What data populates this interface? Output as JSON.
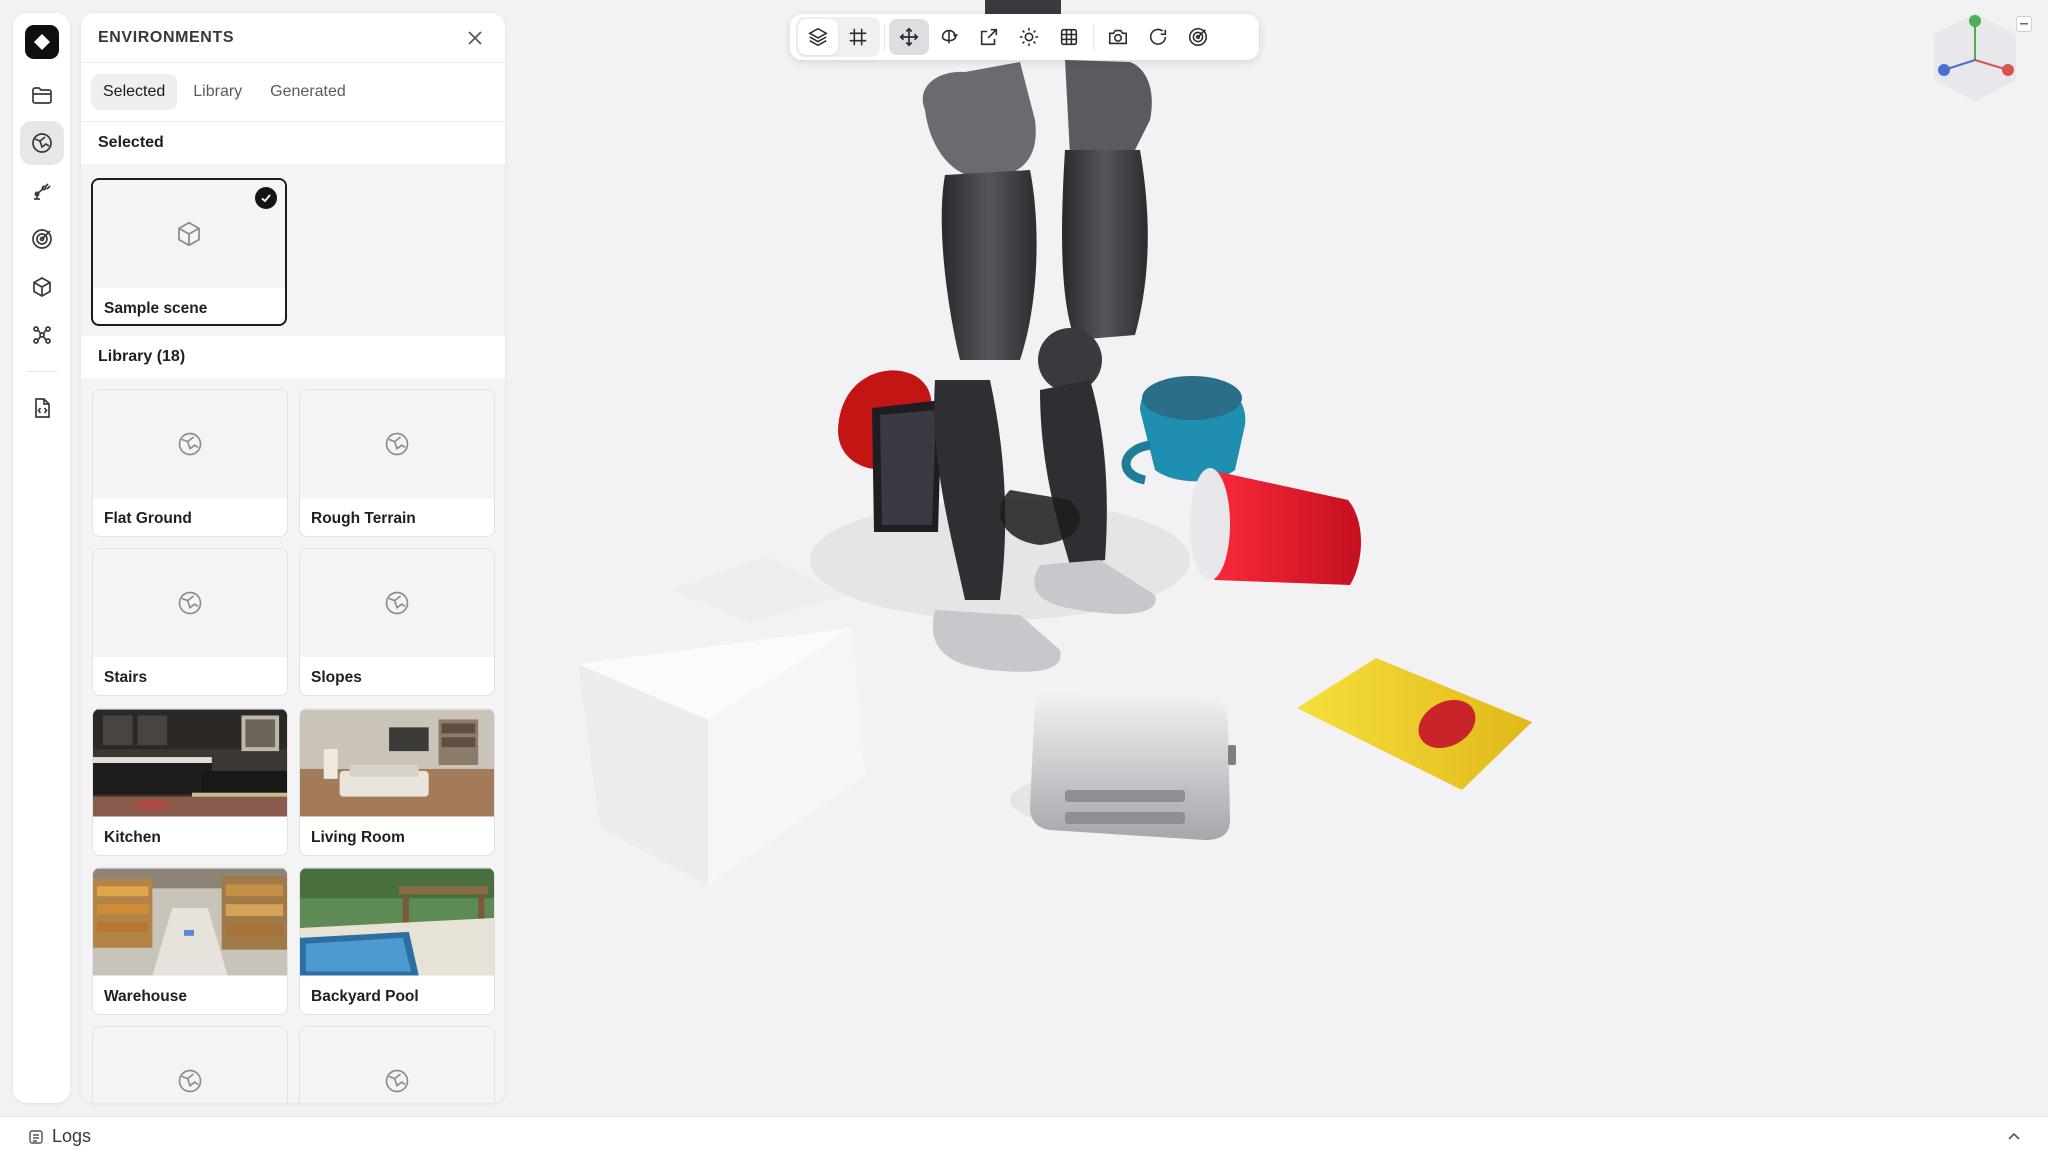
{
  "panel": {
    "title": "ENVIRONMENTS",
    "tabs": [
      "Selected",
      "Library",
      "Generated"
    ],
    "active_tab": "Selected",
    "selected_section": {
      "label": "Selected",
      "items": [
        {
          "name": "Sample scene",
          "icon": "cube-icon",
          "selected": true
        }
      ]
    },
    "library_section": {
      "label": "Library (18)",
      "items": [
        {
          "name": "Flat Ground",
          "icon": "globe-icon"
        },
        {
          "name": "Rough Terrain",
          "icon": "globe-icon"
        },
        {
          "name": "Stairs",
          "icon": "globe-icon"
        },
        {
          "name": "Slopes",
          "icon": "globe-icon"
        },
        {
          "name": "Kitchen",
          "icon": "kitchen-thumbnail"
        },
        {
          "name": "Living Room",
          "icon": "living-room-thumbnail"
        },
        {
          "name": "Warehouse",
          "icon": "warehouse-thumbnail"
        },
        {
          "name": "Backyard Pool",
          "icon": "pool-thumbnail"
        },
        {
          "name": "",
          "icon": "globe-icon"
        },
        {
          "name": "",
          "icon": "globe-icon"
        }
      ]
    }
  },
  "rail": {
    "items": [
      "files-icon",
      "environment-icon",
      "robot-arm-icon",
      "target-icon",
      "object-cube-icon",
      "graph-icon",
      "code-file-icon"
    ],
    "active": "environment-icon"
  },
  "toolbar": {
    "items": [
      "layers-icon",
      "grid-frame-icon",
      "move-icon",
      "rotate-icon",
      "scale-icon",
      "light-icon",
      "table-grid-icon",
      "camera-icon",
      "reset-icon",
      "target-icon"
    ],
    "active": [
      "layers-icon",
      "move-icon"
    ]
  },
  "gizmo": {
    "axes": [
      "x",
      "y",
      "z"
    ],
    "colors": {
      "x": "#d9534f",
      "y": "#4caf50",
      "z": "#4a6fd1"
    }
  },
  "logs": {
    "label": "Logs"
  }
}
